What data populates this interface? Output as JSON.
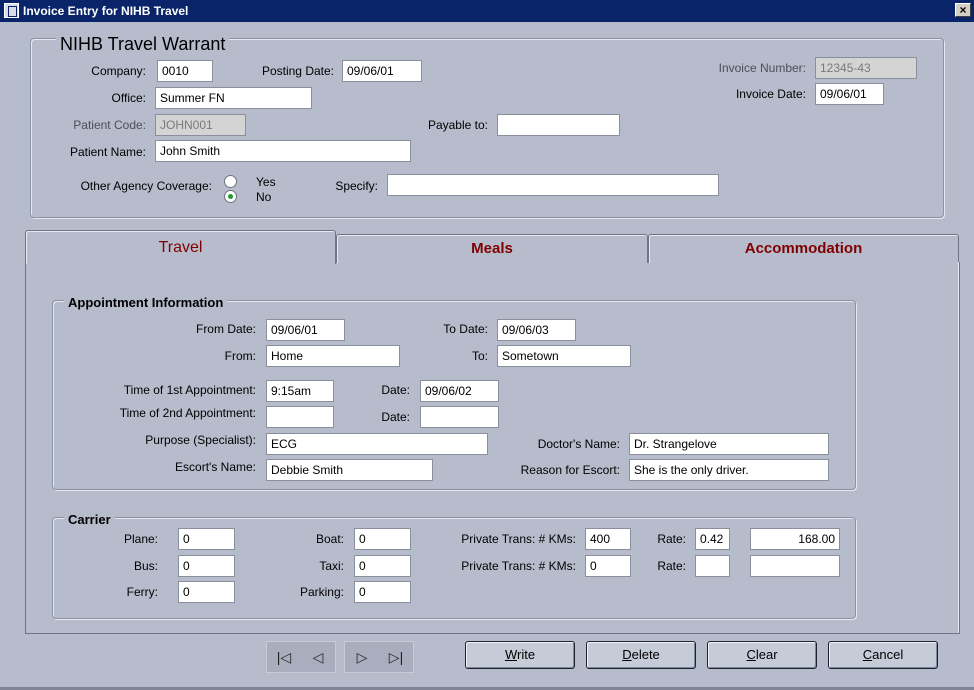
{
  "window": {
    "title": "Invoice Entry for NIHB Travel",
    "close_symbol": "×"
  },
  "warrant": {
    "title": "NIHB Travel Warrant",
    "company_label": "Company:",
    "company": "0010",
    "posting_date_label": "Posting Date:",
    "posting_date": "09/06/01",
    "invoice_number_label": "Invoice Number:",
    "invoice_number": "12345-43",
    "invoice_date_label": "Invoice Date:",
    "invoice_date": "09/06/01",
    "office_label": "Office:",
    "office": "Summer FN",
    "patient_code_label": "Patient Code:",
    "patient_code": "JOHN001",
    "payable_to_label": "Payable to:",
    "payable_to": "",
    "patient_name_label": "Patient Name:",
    "patient_name": "John Smith",
    "coverage_label": "Other Agency Coverage:",
    "coverage_yes": "Yes",
    "coverage_no": "No",
    "coverage_selected": "No",
    "specify_label": "Specify:",
    "specify": ""
  },
  "tabs": [
    {
      "label": "Travel",
      "active": true
    },
    {
      "label": "Meals",
      "active": false
    },
    {
      "label": "Accommodation",
      "active": false
    }
  ],
  "appointment": {
    "title": "Appointment Information",
    "from_date_label": "From Date:",
    "from_date": "09/06/01",
    "to_date_label": "To Date:",
    "to_date": "09/06/03",
    "from_label": "From:",
    "from": "Home",
    "to_label": "To:",
    "to": "Sometown",
    "appt1_label": "Time of 1st Appointment:",
    "appt1_time": "9:15am",
    "appt1_date_label": "Date:",
    "appt1_date": "09/06/02",
    "appt2_label": "Time of 2nd Appointment:",
    "appt2_time": "",
    "appt2_date_label": "Date:",
    "appt2_date": "",
    "purpose_label": "Purpose (Specialist):",
    "purpose": "ECG",
    "doctor_label": "Doctor's Name:",
    "doctor": "Dr. Strangelove",
    "escort_label": "Escort's Name:",
    "escort": "Debbie Smith",
    "reason_label": "Reason for Escort:",
    "reason": "She is the only driver."
  },
  "carrier": {
    "title": "Carrier",
    "plane_label": "Plane:",
    "plane": "0",
    "bus_label": "Bus:",
    "bus": "0",
    "ferry_label": "Ferry:",
    "ferry": "0",
    "boat_label": "Boat:",
    "boat": "0",
    "taxi_label": "Taxi:",
    "taxi": "0",
    "parking_label": "Parking:",
    "parking": "0",
    "private1_label": "Private Trans: # KMs:",
    "private1_kms": "400",
    "rate1_label": "Rate:",
    "rate1": "0.42",
    "total1": "168.00",
    "private2_label": "Private Trans: # KMs:",
    "private2_kms": "0",
    "rate2_label": "Rate:",
    "rate2": "",
    "total2": ""
  },
  "nav": {
    "first": "|◁",
    "prev": "◁",
    "next": "▷",
    "last": "▷|"
  },
  "buttons": {
    "write_u": "W",
    "write_rest": "rite",
    "delete_u": "D",
    "delete_rest": "elete",
    "clear_u": "C",
    "clear_rest": "lear",
    "cancel_u": "C",
    "cancel_rest": "ancel"
  }
}
